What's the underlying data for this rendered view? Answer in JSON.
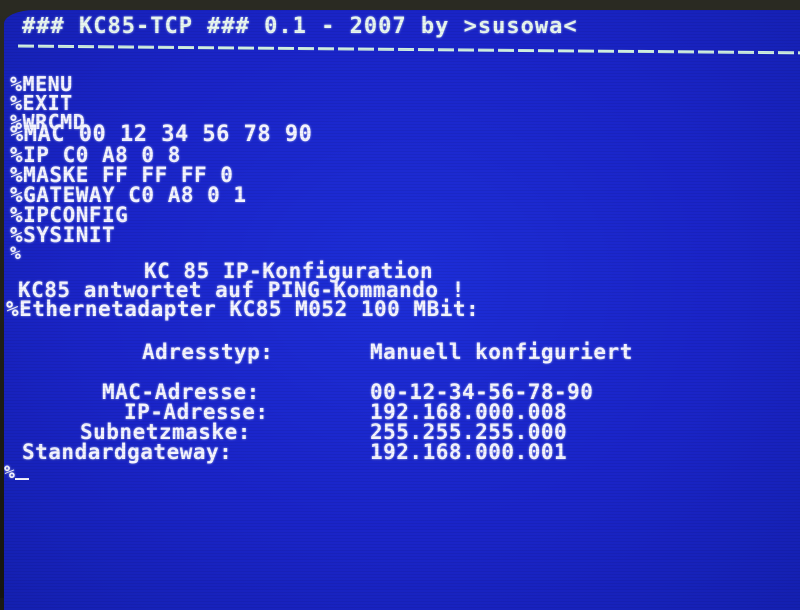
{
  "header": {
    "title": "### KC85-TCP ### 0.1 - 2007 by >susowa<"
  },
  "commands": [
    "%MENU",
    "%EXIT",
    "%WRCMD",
    "%MAC 00 12 34 56 78 90",
    "%IP C0 A8 0 8",
    "%MASKE FF FF FF 0",
    "%GATEWAY C0 A8 0 1",
    "%IPCONFIG",
    "%SYSINIT",
    "%"
  ],
  "ipconfig": {
    "heading": "KC 85 IP-Konfiguration",
    "ping_message": "KC85 antwortet auf PING-Kommando !",
    "adapter_line": "%Ethernetadapter KC85 M052 100 MBit:",
    "address_type_label": "Adresstyp:",
    "address_type_value": "Manuell konfiguriert",
    "fields": [
      {
        "label": "MAC-Adresse:",
        "value": "00-12-34-56-78-90"
      },
      {
        "label": "IP-Adresse:",
        "value": "192.168.000.008"
      },
      {
        "label": "Subnetzmaske:",
        "value": "255.255.255.000"
      },
      {
        "label": "Standardgateway:",
        "value": "192.168.000.001"
      }
    ]
  },
  "prompt": "%",
  "colors": {
    "screen_bg": "#1a24c8",
    "text": "#f4f4ff",
    "title_text": "#e8f6f0"
  }
}
